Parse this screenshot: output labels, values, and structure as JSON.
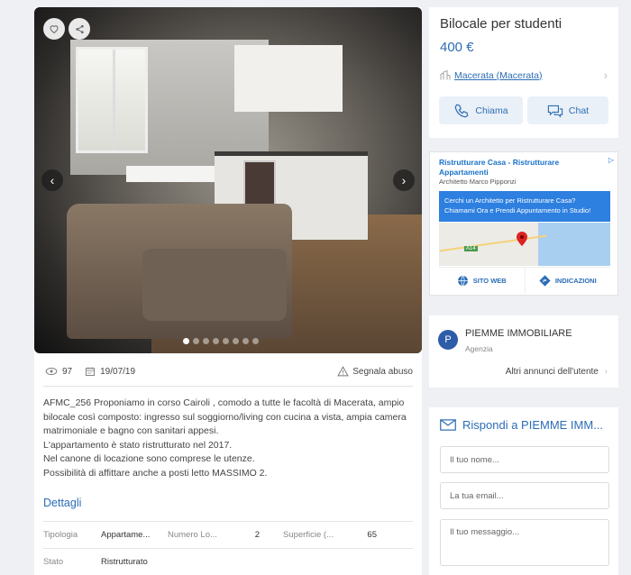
{
  "listing": {
    "title": "Bilocale per studenti",
    "price": "400 €",
    "location": "Macerata (Macerata)",
    "call_label": "Chiama",
    "chat_label": "Chat"
  },
  "gallery": {
    "total_photos": 8,
    "current_index": 1
  },
  "meta": {
    "views": "97",
    "date": "19/07/19",
    "report_label": "Segnala abuso"
  },
  "description": [
    "AFMC_256 Proponiamo in corso Cairoli , comodo a tutte le facoltà di Macerata, ampio bilocale così composto: ingresso sul soggiorno/living con cucina a vista, ampia camera matrimoniale e bagno con sanitari appesi.",
    "L'appartamento è stato ristrutturato nel 2017.",
    "Nel canone di locazione sono comprese le utenze.",
    "Possibilità di affittare anche a posti letto MASSIMO 2."
  ],
  "details_link": "Dettagli",
  "specs": {
    "row1": {
      "tipologia_label": "Tipologia",
      "tipologia_value": "Appartame...",
      "numero_label": "Numero Lo...",
      "numero_value": "2",
      "superficie_label": "Superficie (...",
      "superficie_value": "65"
    },
    "row2": {
      "stato_label": "Stato",
      "stato_value": "Ristrutturato"
    }
  },
  "ad": {
    "headline": "Ristrutturare Casa - Ristrutturare Appartamenti",
    "advertiser": "Architetto Marco Pipponzi",
    "body": "Cerchi un Architetto per Ristrutturare Casa? Chiamami Ora e Prendi Appuntamento in Studio!",
    "website_label": "SITO WEB",
    "directions_label": "INDICAZIONI",
    "map_road_label": "A14"
  },
  "agency": {
    "initial": "P",
    "name": "PIEMME IMMOBILIARE",
    "type": "Agenzia",
    "other_ads": "Altri annunci dell'utente"
  },
  "contact": {
    "heading": "Rispondi a PIEMME IMM...",
    "name_placeholder": "Il tuo nome...",
    "email_placeholder": "La tua email...",
    "message_placeholder": "Il tuo messaggio..."
  },
  "colors": {
    "accent": "#2c6db5",
    "button_bg": "#eaf0f7",
    "page_bg": "#eef0f3"
  }
}
